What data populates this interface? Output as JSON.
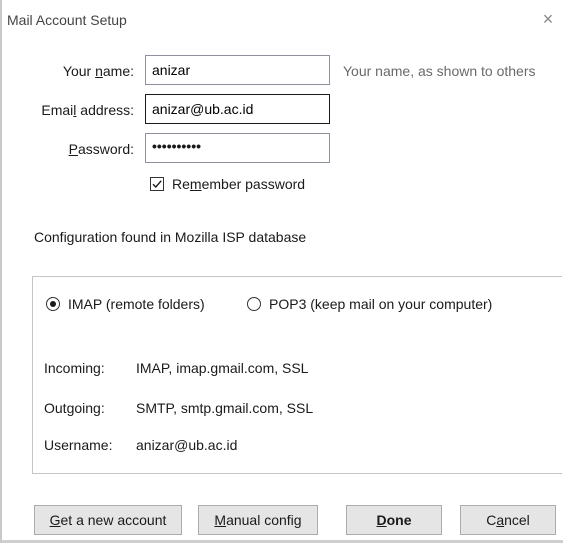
{
  "window": {
    "title": "Mail Account Setup",
    "close_glyph": "×"
  },
  "form": {
    "name": {
      "label_pre": "Your ",
      "label_u": "n",
      "label_post": "ame:",
      "value": "anizar",
      "hint": "Your name, as shown to others"
    },
    "email": {
      "label_pre": "Emai",
      "label_u": "l",
      "label_post": " address:",
      "value": "anizar@ub.ac.id"
    },
    "password": {
      "label_pre": "",
      "label_u": "P",
      "label_post": "assword:",
      "masked_value": "••••••••••"
    },
    "remember": {
      "label_pre": "Re",
      "label_u": "m",
      "label_post": "ember password",
      "checked": true
    }
  },
  "status": {
    "config_found": "Configuration found in Mozilla ISP database"
  },
  "protocol": {
    "imap_label": "IMAP (remote folders)",
    "pop3_label": "POP3 (keep mail on your computer)",
    "selected": "imap"
  },
  "server_info": {
    "incoming_label": "Incoming:",
    "incoming_value": "IMAP, imap.gmail.com, SSL",
    "outgoing_label": "Outgoing:",
    "outgoing_value": "SMTP, smtp.gmail.com, SSL",
    "username_label": "Username:",
    "username_value": "anizar@ub.ac.id"
  },
  "buttons": {
    "get_account": {
      "u": "G",
      "rest": "et a new account"
    },
    "manual_config": {
      "u": "M",
      "rest": "anual config"
    },
    "done": {
      "u": "D",
      "rest": "one"
    },
    "cancel": {
      "pre": "C",
      "u": "a",
      "rest": "ncel"
    }
  }
}
